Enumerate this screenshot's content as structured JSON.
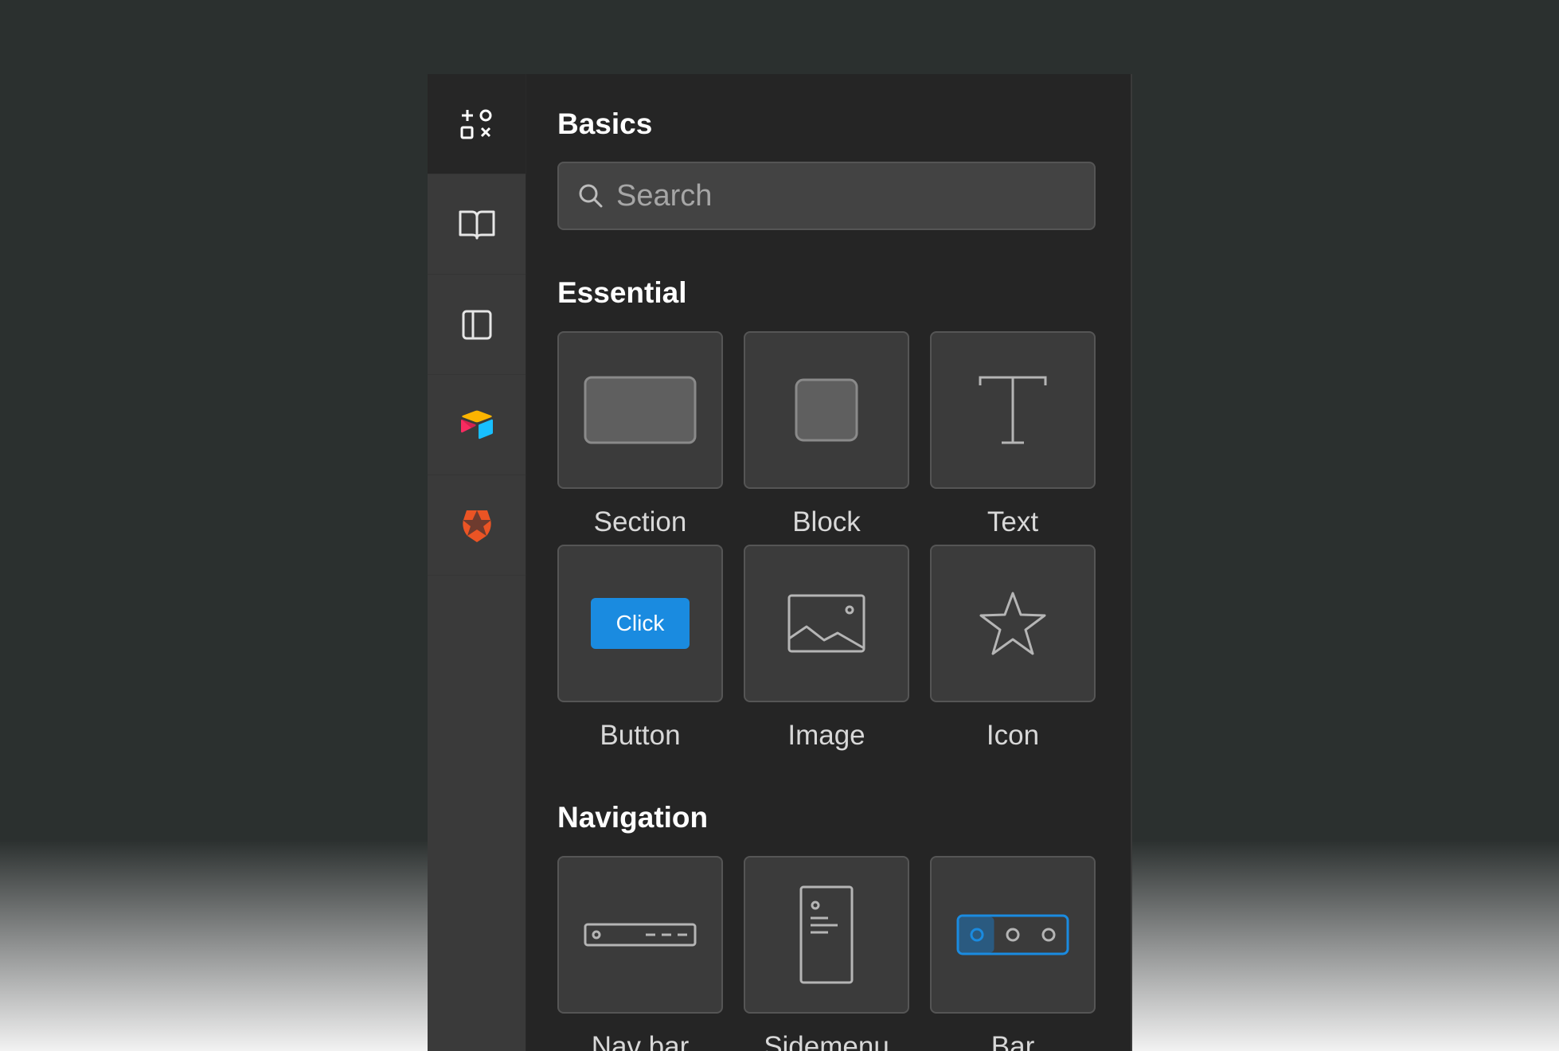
{
  "rail": {
    "items": [
      {
        "name": "elements",
        "icon": "elements-icon",
        "active": true
      },
      {
        "name": "library",
        "icon": "book-icon",
        "active": false
      },
      {
        "name": "layout",
        "icon": "sidebar-layout-icon",
        "active": false
      },
      {
        "name": "airtable",
        "icon": "airtable-logo-icon",
        "active": false
      },
      {
        "name": "auth0",
        "icon": "auth0-logo-icon",
        "active": false
      }
    ]
  },
  "panel": {
    "title": "Basics",
    "search": {
      "placeholder": "Search",
      "value": ""
    }
  },
  "groups": {
    "essential": {
      "title": "Essential",
      "items": [
        {
          "label": "Section",
          "icon": "section-icon"
        },
        {
          "label": "Block",
          "icon": "block-icon"
        },
        {
          "label": "Text",
          "icon": "text-icon"
        },
        {
          "label": "Button",
          "icon": "button-preview",
          "preview_text": "Click"
        },
        {
          "label": "Image",
          "icon": "image-icon"
        },
        {
          "label": "Icon",
          "icon": "star-icon"
        }
      ]
    },
    "navigation": {
      "title": "Navigation",
      "items": [
        {
          "label": "Nav bar",
          "icon": "navbar-icon"
        },
        {
          "label": "Sidemenu",
          "icon": "sidemenu-icon"
        },
        {
          "label": "Bar",
          "icon": "tab-bar-icon"
        }
      ]
    }
  },
  "colors": {
    "accent": "#1a8be0",
    "panel_bg": "#252525",
    "rail_bg": "#3a3a3a",
    "tile_bg": "#3b3b3b",
    "auth0_orange": "#eb5424"
  }
}
